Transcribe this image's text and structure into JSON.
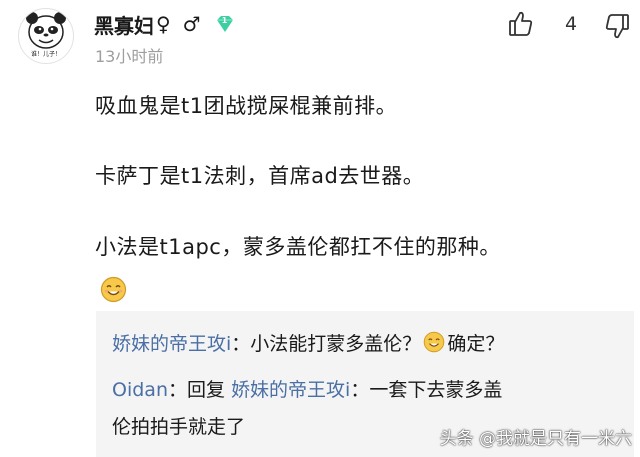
{
  "comment": {
    "author": {
      "name": "黑寡妇",
      "gender_symbols": [
        "♀",
        "♂"
      ],
      "badge_level": "1",
      "avatar_caption": "谁！儿子！"
    },
    "time": "13小时前",
    "like_count": "4",
    "lines": [
      "吸血鬼是t1团战搅屎棍兼前排。",
      "卡萨丁是t1法刺，首席ad去世器。",
      "小法是t1apc，蒙多盖伦都扛不住的那种。"
    ],
    "trailing_emoji": "smile-emoji"
  },
  "replies": [
    {
      "author": "娇妹的帝王攻i",
      "separator": "：",
      "text_before_emoji": "小法能打蒙多盖伦？",
      "emoji": "smile-emoji",
      "text_after_emoji": "确定？"
    },
    {
      "author": "Oidan",
      "separator": "：",
      "reply_word": "回复 ",
      "reply_to": "娇妹的帝王攻i",
      "text_line1": "：一套下去蒙多盖",
      "text_line2": "伦拍拍手就走了"
    }
  ],
  "watermark": "头条 @我就是只有一米六",
  "colors": {
    "link": "#4a6fa5",
    "reply_background": "#f4f4f4",
    "timestamp": "#9e9e9e",
    "badge": "#3ccfa0"
  }
}
